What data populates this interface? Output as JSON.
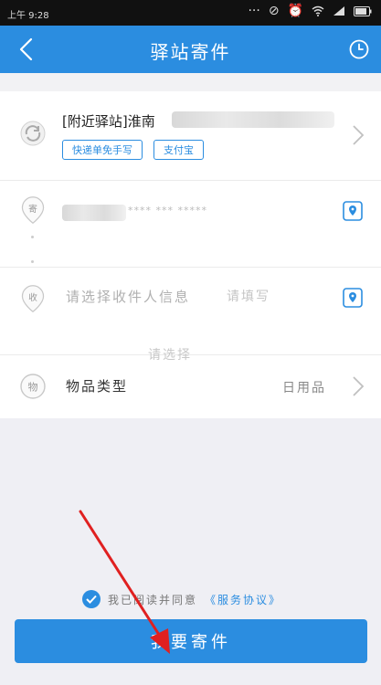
{
  "status_bar": {
    "time": "上午 9:28"
  },
  "nav": {
    "title": "驿站寄件",
    "back_icon": "chevron-left-icon",
    "history_icon": "clock-icon"
  },
  "station": {
    "label": "[附近驿站]淮南",
    "tags": [
      "快递单免手写",
      "支付宝"
    ]
  },
  "sender": {
    "phone_partial": "**** *** *****"
  },
  "receiver": {
    "placeholder": "请选择收件人信息"
  },
  "ghost_hints": [
    "请填写",
    "请选择"
  ],
  "goods": {
    "label": "物品类型",
    "value": "日用品"
  },
  "agreement": {
    "prefix": "我已阅读并同意",
    "link": "《服务协议》"
  },
  "submit": {
    "label": "我要寄件"
  },
  "colors": {
    "accent": "#2b8de0",
    "annotation_arrow": "#e02020"
  }
}
